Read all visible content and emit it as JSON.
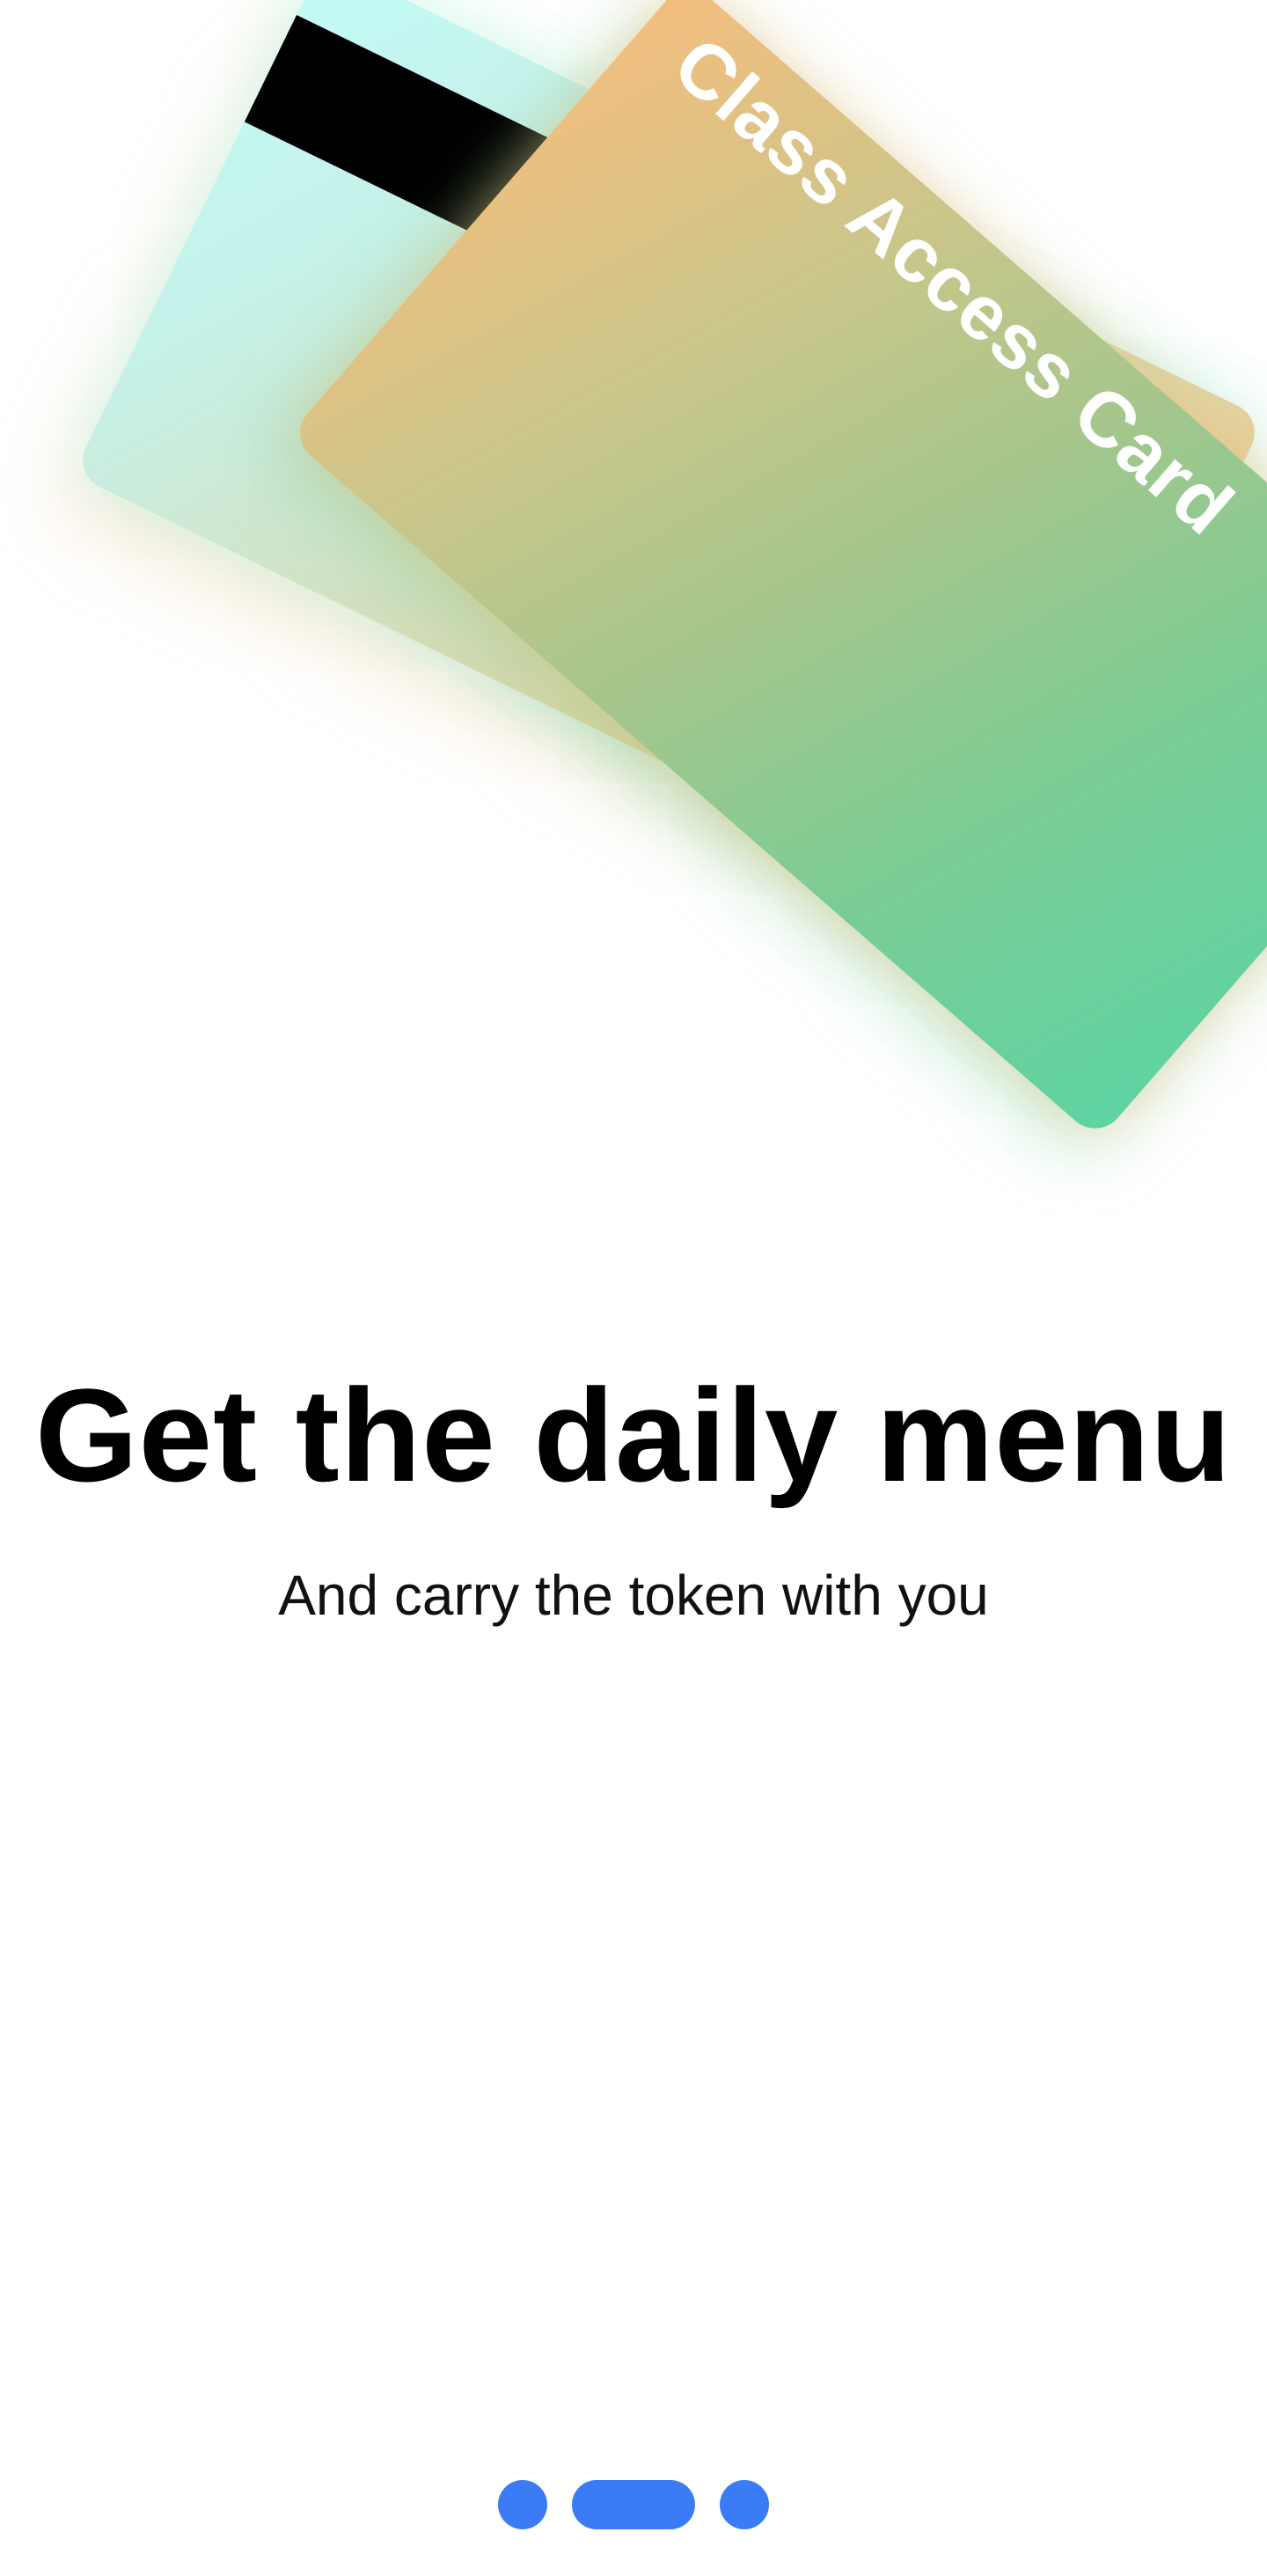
{
  "hero": {
    "card_label": "Class Access Card"
  },
  "onboarding": {
    "title": "Get the daily menu",
    "subtitle": "And carry the token with you"
  },
  "pager": {
    "page_count": 3,
    "active_page": 2,
    "color": "#3b7cf6"
  },
  "colors": {
    "back_card_gradient": [
      "#c4fbf8",
      "#f2c486"
    ],
    "front_card_gradient": [
      "#f4be7e",
      "#5ed3a3"
    ],
    "magnetic_stripe": "#000000"
  }
}
